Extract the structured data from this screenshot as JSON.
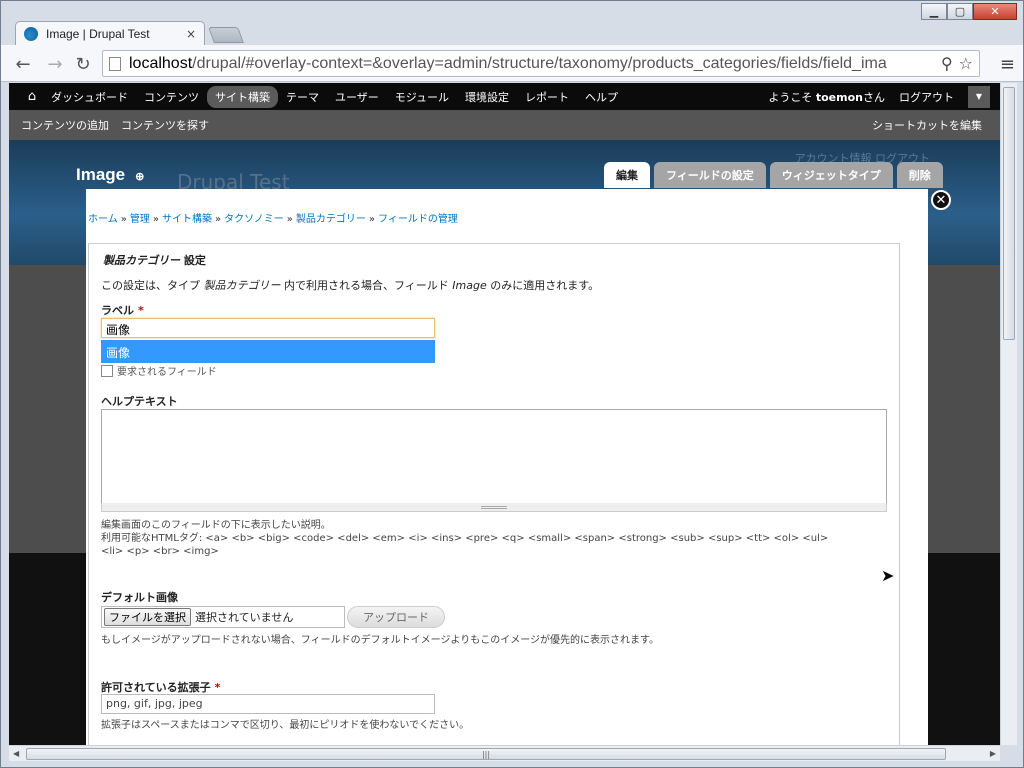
{
  "browser": {
    "tab_title": "Image | Drupal Test",
    "tab_close": "×",
    "url_host": "localhost",
    "url_path": "/drupal/#overlay-context=&overlay=admin/structure/taxonomy/products_categories/fields/field_ima",
    "icons": [
      "back-icon",
      "forward-icon",
      "reload-icon",
      "page-icon",
      "search-icon",
      "star-icon",
      "menu-icon"
    ]
  },
  "admin_menu": {
    "items": [
      "ダッシュボード",
      "コンテンツ",
      "サイト構築",
      "テーマ",
      "ユーザー",
      "モジュール",
      "環境設定",
      "レポート",
      "ヘルプ"
    ],
    "active": "サイト構築",
    "welcome_prefix": "ようこそ ",
    "username": "toemon",
    "welcome_suffix": "さん",
    "logout": "ログアウト"
  },
  "shortcuts": {
    "items": [
      "コンテンツの追加",
      "コンテンツを探す"
    ],
    "edit": "ショートカットを編集"
  },
  "site": {
    "name": "Drupal Test",
    "links": "アカウント情報   ログアウト"
  },
  "overlay": {
    "title": "Image",
    "tabs": [
      "編集",
      "フィールドの設定",
      "ウィジェットタイプ",
      "削除"
    ],
    "active_tab": "編集",
    "breadcrumb": [
      "ホーム",
      "管理",
      "サイト構築",
      "タクソノミー",
      "製品カテゴリー",
      "フィールドの管理"
    ]
  },
  "form": {
    "legend_name": "製品カテゴリー",
    "legend_suffix": " 設定",
    "intro_a": "この設定は、タイプ ",
    "intro_type": "製品カテゴリー",
    "intro_b": " 内で利用される場合、フィールド ",
    "intro_field": "Image",
    "intro_c": " のみに適用されます。",
    "label_label": "ラベル",
    "label_value": "画像",
    "autocomplete": "画像",
    "required_label": "要求されるフィールド",
    "help_label": "ヘルプテキスト",
    "help_desc1": "編集画面のこのフィールドの下に表示したい説明。",
    "help_desc2": "利用可能なHTMLタグ: <a> <b> <big> <code> <del> <em> <i> <ins> <pre> <q> <small> <span> <strong> <sub> <sup> <tt> <ol> <ul>",
    "help_desc3": "<li> <p> <br> <img>",
    "default_image_label": "デフォルト画像",
    "file_button": "ファイルを選択",
    "file_status": "選択されていません",
    "upload_button": "アップロード",
    "default_image_desc": "もしイメージがアップロードされない場合、フィールドのデフォルトイメージよりもこのイメージが優先的に表示されます。",
    "ext_label": "許可されている拡張子",
    "ext_value": "png, gif, jpg, jpeg",
    "ext_desc": "拡張子はスペースまたはコンマで区切り、最初にピリオドを使わないでください。",
    "required_mark": "*"
  }
}
